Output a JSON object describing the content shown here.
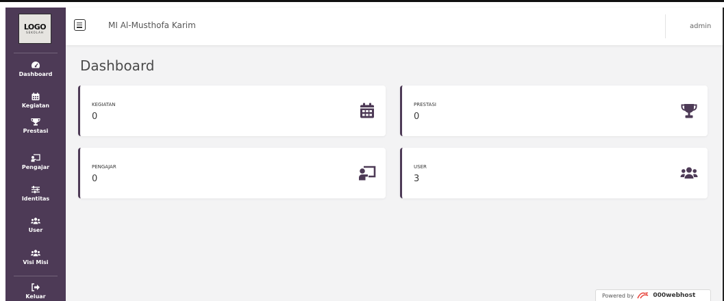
{
  "logo": {
    "main": "LOGO",
    "sub": "SEKOLAH"
  },
  "sidebar": {
    "items": [
      {
        "label": "Dashboard",
        "icon": "tachometer-icon"
      },
      {
        "label": "Kegiatan",
        "icon": "calendar-icon"
      },
      {
        "label": "Prestasi",
        "icon": "trophy-icon"
      },
      {
        "label": "Pengajar",
        "icon": "chalkboard-teacher-icon"
      },
      {
        "label": "Identitas",
        "icon": "sliders-icon"
      },
      {
        "label": "User",
        "icon": "users-icon"
      },
      {
        "label": "Visi Misi",
        "icon": "users-icon"
      }
    ],
    "logout": {
      "label": "Keluar",
      "icon": "sign-out-icon"
    }
  },
  "topbar": {
    "title": "MI Al-Musthofa Karim",
    "user": "admin"
  },
  "page": {
    "title": "Dashboard"
  },
  "cards": [
    {
      "label": "KEGIATAN",
      "value": "0",
      "icon": "calendar-icon"
    },
    {
      "label": "PRESTASI",
      "value": "0",
      "icon": "trophy-icon"
    },
    {
      "label": "PENGAJAR",
      "value": "0",
      "icon": "chalkboard-teacher-icon"
    },
    {
      "label": "USER",
      "value": "3",
      "icon": "users-icon"
    }
  ],
  "footer": {
    "powered_by": "Powered by",
    "brand": "000webhost"
  },
  "colors": {
    "sidebar": "#4d3a56",
    "accent": "#4d3a56",
    "content_bg": "#f3f3f4",
    "brand_red": "#e8473f"
  }
}
